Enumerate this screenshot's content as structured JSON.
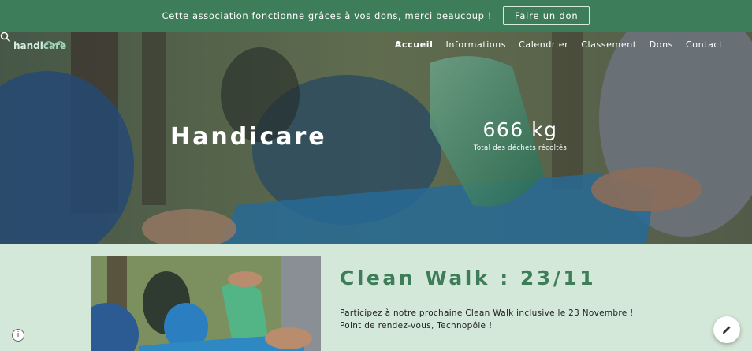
{
  "announcement": {
    "text": "Cette association fonctionne grâces à vos dons, merci beaucoup !",
    "button_label": "Faire un don"
  },
  "logo": {
    "part1": "handi",
    "part2": "care"
  },
  "nav": {
    "items": [
      {
        "label": "Accueil",
        "active": true
      },
      {
        "label": "Informations",
        "has_dropdown": true
      },
      {
        "label": "Calendrier"
      },
      {
        "label": "Classement"
      },
      {
        "label": "Dons"
      },
      {
        "label": "Contact"
      }
    ],
    "search_icon": "search-icon"
  },
  "hero": {
    "title": "Handicare",
    "stat_value": "666 kg",
    "stat_label": "Total des déchets récoltés"
  },
  "event": {
    "title": "Clean Walk : 23/11",
    "description": "Participez à notre prochaine Clean Walk inclusive le 23 Novembre ! Point de rendez-vous, Technopôle !"
  },
  "colors": {
    "primary_green": "#3e7d5a",
    "section_bg": "#d4e8d9"
  },
  "icons": {
    "info": "info-icon",
    "edit": "pencil-icon",
    "dropdown": "chevron-down-icon"
  }
}
